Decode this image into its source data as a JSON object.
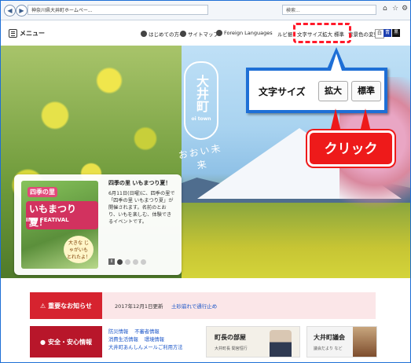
{
  "browser": {
    "back": "◀",
    "forward": "▶",
    "address": "神奈川県大井町ホームペー...",
    "search_placeholder": "検索...",
    "icons": [
      "home-icon",
      "star-icon",
      "gear-icon"
    ]
  },
  "header": {
    "menu_label": "メニュー",
    "nav": [
      {
        "label": "はじめての方へ"
      },
      {
        "label": "サイトマップ"
      },
      {
        "label": "Foreign Languages"
      }
    ],
    "ruby_label": "ルビ振",
    "font_size_label": "文字サイズ",
    "font_enlarge": "拡大",
    "font_standard": "標準",
    "bg_color_label": "背景色の変更",
    "color_white": "白",
    "color_blue": "青",
    "color_black": "黒"
  },
  "hero": {
    "logo_text": "大井町",
    "logo_sub": "oi town",
    "logo_script": "おおい未来"
  },
  "event": {
    "image_tag": "四季の里",
    "image_title": "いもまつり",
    "image_badge": "夏！",
    "image_en": "IMO FEATIVAL",
    "image_bubble": "大きな じゃがいも とれたよ！",
    "title": "四季の里 いもまつり夏！",
    "description": "6月11日(日曜)に、四季の里で「四季の里 いもまつり夏」が開催されます。名前のとおり、いもを楽しむ、体験できるイベントです。",
    "pause": "II"
  },
  "callout": {
    "label": "文字サイズ",
    "enlarge": "拡大",
    "standard": "標準",
    "click": "クリック"
  },
  "notice": {
    "tag": "重要なお知らせ",
    "date": "2017年12月1日更新",
    "link": "土砂崩れで通行止め"
  },
  "safety": {
    "tag": "安全・安心情報",
    "links_row1": [
      "防災情報",
      "不審者情報"
    ],
    "links_row2": [
      "消費生活情報",
      "環境情報"
    ],
    "links_row3": [
      "大井町あんしんメールご利用方法"
    ]
  },
  "mayor": {
    "title": "町長の部屋",
    "sub": "大井町長 間宮恒行"
  },
  "council": {
    "title": "大井町議会",
    "sub": "議会だより など"
  }
}
